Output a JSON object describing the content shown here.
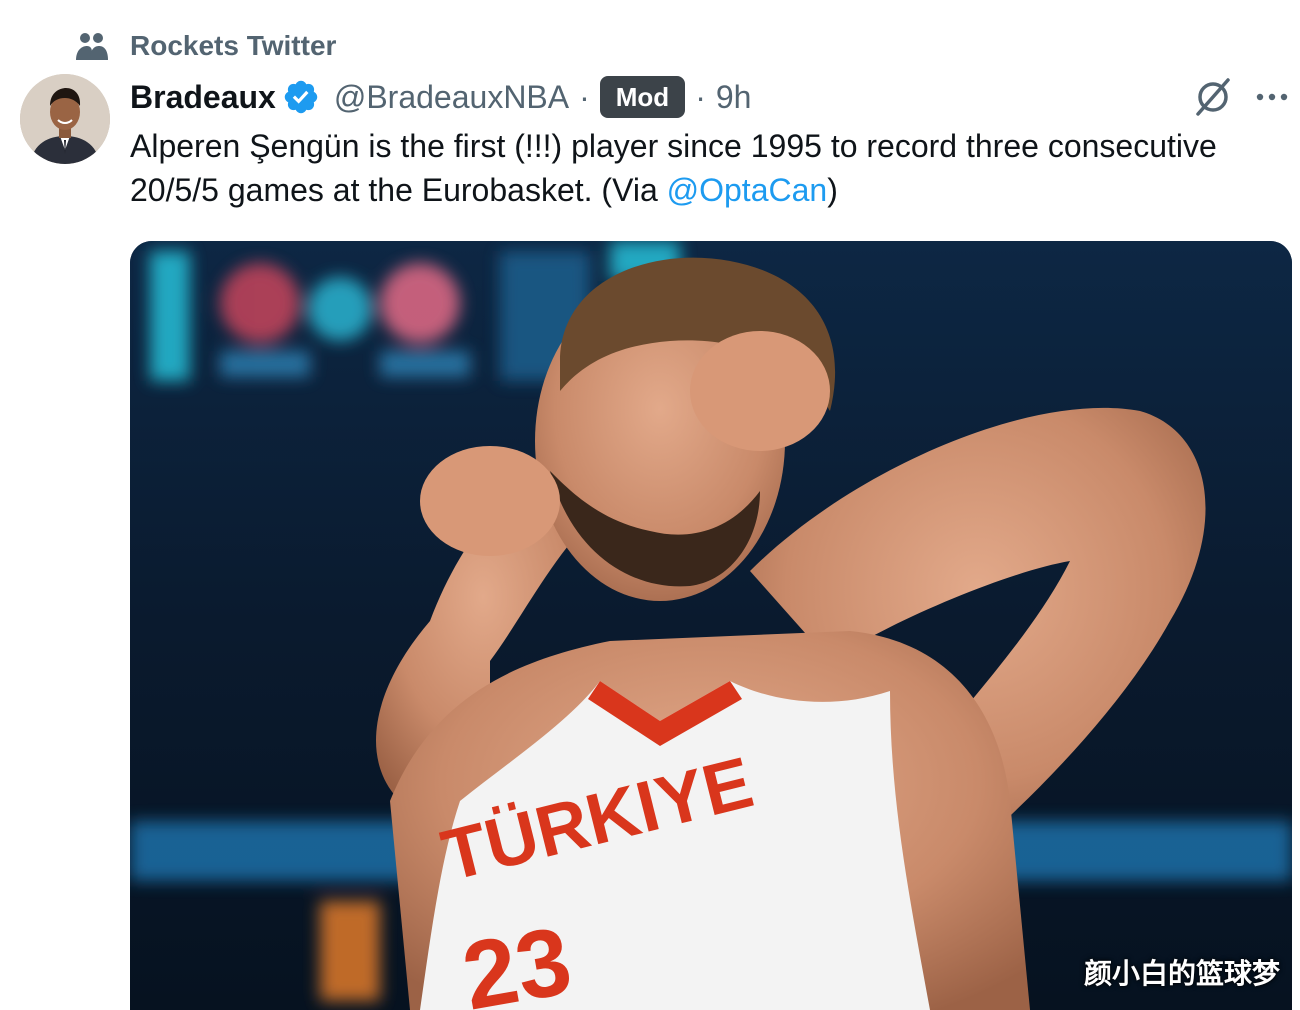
{
  "context": {
    "label": "Rockets Twitter",
    "icon": "community-icon"
  },
  "author": {
    "name": "Bradeaux",
    "handle": "@BradeauxNBA",
    "separator": "·",
    "badge": "Mod",
    "time": "9h",
    "verified": true,
    "verified_color": "#1d9bf0"
  },
  "tweet": {
    "text_prefix": "Alperen Şengün is the first (!!!) player since 1995 to record three consecutive 20/5/5 games at the Eurobasket. (Via ",
    "mention": "@OptaCan",
    "text_suffix": ")"
  },
  "media": {
    "jersey_text": "TÜRKIYE",
    "jersey_number": "23",
    "watermark": "颜小白的篮球梦"
  },
  "colors": {
    "link": "#1d9bf0",
    "secondary_text": "#536471",
    "badge_bg": "#3c4349"
  }
}
